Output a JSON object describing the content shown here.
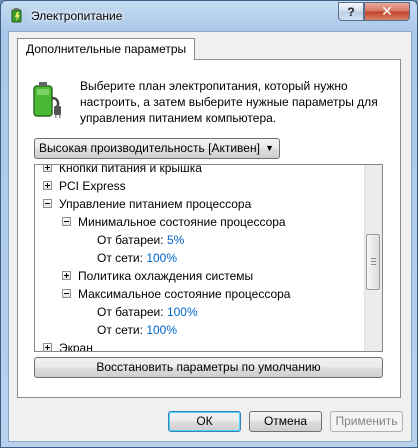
{
  "window": {
    "title": "Электропитание",
    "help_label": "?",
    "close_label": "✕"
  },
  "tab": {
    "label": "Дополнительные параметры"
  },
  "description": "Выберите план электропитания, который нужно настроить, а затем выберите нужные параметры для управления питанием компьютера.",
  "plan_select": {
    "value": "Высокая производительность [Активен]",
    "arrow": "▼"
  },
  "tree": {
    "rows": [
      {
        "label": "Кнопки питания и крышка",
        "expander": "plus",
        "value": ""
      },
      {
        "label": "PCI Express",
        "expander": "plus",
        "value": ""
      },
      {
        "label": "Управление питанием процессора",
        "expander": "minus",
        "value": ""
      },
      {
        "label": "Минимальное состояние процессора",
        "expander": "minus",
        "value": ""
      },
      {
        "label": "От батареи:",
        "expander": "",
        "value": "5%"
      },
      {
        "label": "От сети:",
        "expander": "",
        "value": "100%"
      },
      {
        "label": "Политика охлаждения системы",
        "expander": "plus",
        "value": ""
      },
      {
        "label": "Максимальное состояние процессора",
        "expander": "minus",
        "value": ""
      },
      {
        "label": "От батареи:",
        "expander": "",
        "value": "100%"
      },
      {
        "label": "От сети:",
        "expander": "",
        "value": "100%"
      },
      {
        "label": "Экран",
        "expander": "plus",
        "value": ""
      }
    ]
  },
  "buttons": {
    "restore": "Восстановить параметры по умолчанию",
    "ok": "ОК",
    "cancel": "Отмена",
    "apply": "Применить"
  },
  "colors": {
    "value_link": "#0066cc",
    "titlebar": "#a9c7e8",
    "close_button": "#c2432a"
  },
  "icons": {
    "app": "power-plan-icon",
    "plan": "battery-plug-icon"
  }
}
